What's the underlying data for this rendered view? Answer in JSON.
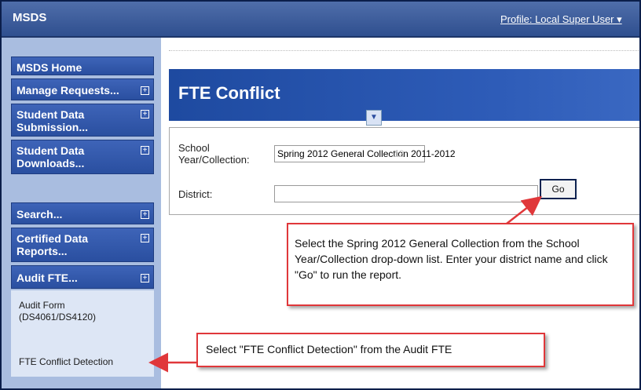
{
  "header": {
    "app_name": "MSDS",
    "profile_link": "Profile: Local Super User ▾"
  },
  "sidebar": {
    "items": [
      {
        "label": "MSDS Home",
        "expandable": false
      },
      {
        "label": "Manage Requests...",
        "expandable": true
      },
      {
        "label": "Student Data Submission...",
        "expandable": true
      },
      {
        "label": "Student Data Downloads...",
        "expandable": true
      },
      {
        "label": "Search...",
        "expandable": true
      },
      {
        "label": "Certified Data Reports...",
        "expandable": true
      },
      {
        "label": "Audit FTE...",
        "expandable": true
      }
    ],
    "audit_subitems": [
      {
        "label": "Audit Form (DS4061/DS4120)"
      },
      {
        "label": "FTE Conflict Detection"
      }
    ],
    "expand_icon": "plus-box-icon"
  },
  "main": {
    "title": "FTE Conflict",
    "form": {
      "school_year_label": "School Year/Collection:",
      "school_year_value": "Spring 2012 General Collection 2011-2012",
      "school_year_ghost": "12",
      "district_label": "District:",
      "district_value": "",
      "go_label": "Go"
    }
  },
  "callouts": {
    "report_instructions": "Select the Spring 2012 General Collection from the School Year/Collection drop-down list. Enter your district name and click \"Go\" to run the report.",
    "menu_instructions": "Select \"FTE Conflict Detection\" from the Audit FTE"
  },
  "colors": {
    "banner": "#2e5cb8",
    "nav_button": "#3e64b8",
    "sidebar_bg": "#a9bde0",
    "callout_border": "#e0373a"
  }
}
